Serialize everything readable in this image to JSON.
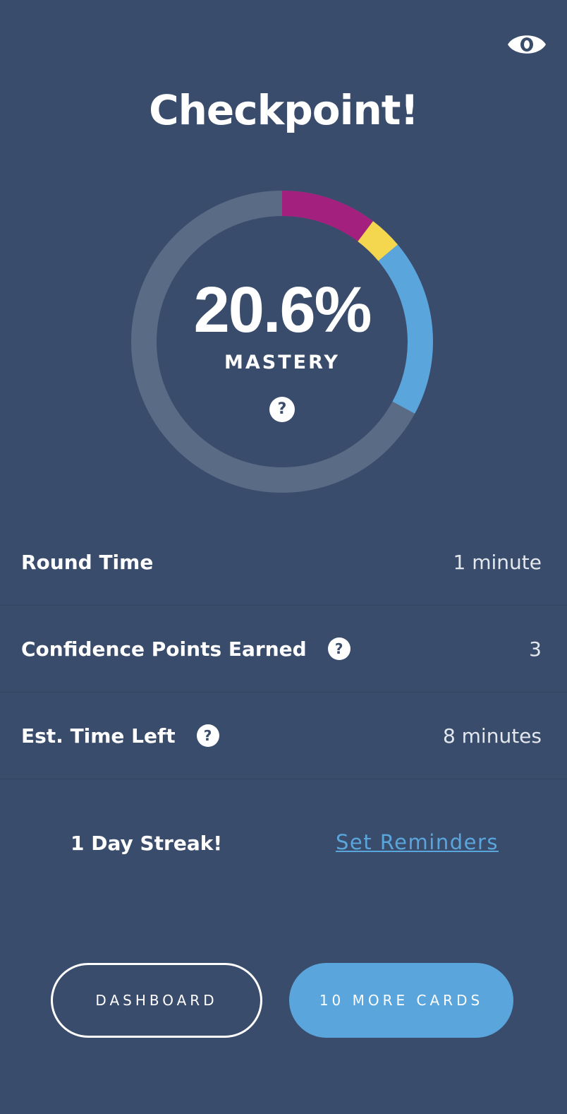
{
  "header": {
    "title": "Checkpoint!",
    "toggle_icon": "eye-icon"
  },
  "mastery": {
    "percent_text": "20.6%",
    "percent": 20.6,
    "label": "MASTERY",
    "help_icon": "question-circle-icon",
    "help_glyph": "?",
    "segments": [
      {
        "name": "level-5",
        "color": "#a3207e",
        "fraction": 0.103
      },
      {
        "name": "level-4",
        "color": "#f5d64f",
        "fraction": 0.036
      },
      {
        "name": "level-3",
        "color": "#5aa5dc",
        "fraction": 0.19
      }
    ],
    "track_color": "#5a6b86"
  },
  "stats": [
    {
      "label": "Round Time",
      "value": "1 minute",
      "has_help": false
    },
    {
      "label": "Confidence Points Earned",
      "value": "3",
      "has_help": true
    },
    {
      "label": "Est. Time Left",
      "value": "8 minutes",
      "has_help": true
    }
  ],
  "streak": {
    "text": "1 Day Streak!",
    "reminders_link": "Set Reminders"
  },
  "actions": {
    "dashboard_label": "DASHBOARD",
    "more_cards_label": "10 MORE CARDS"
  },
  "colors": {
    "background": "#3a4c6b",
    "accent": "#5aa5dc"
  }
}
